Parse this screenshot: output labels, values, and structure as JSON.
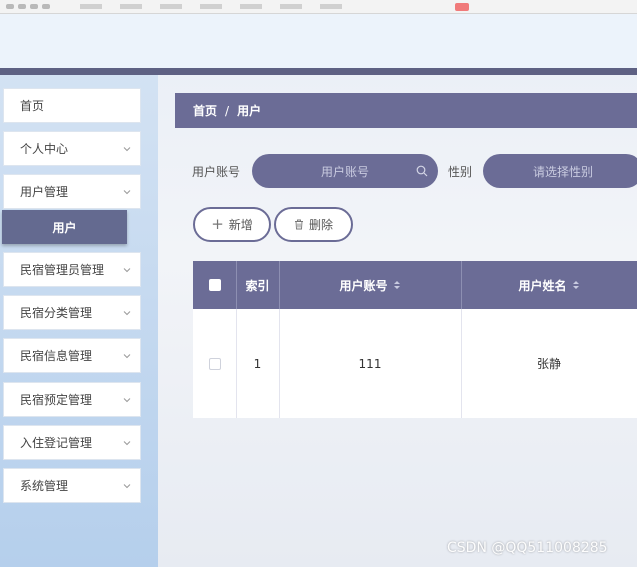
{
  "sidebar": {
    "items": [
      {
        "label": "首页",
        "has_chevron": false
      },
      {
        "label": "个人中心",
        "has_chevron": true
      },
      {
        "label": "用户管理",
        "has_chevron": true
      },
      {
        "label": "民宿管理员管理",
        "has_chevron": true
      },
      {
        "label": "民宿分类管理",
        "has_chevron": true
      },
      {
        "label": "民宿信息管理",
        "has_chevron": true
      },
      {
        "label": "民宿预定管理",
        "has_chevron": true
      },
      {
        "label": "入住登记管理",
        "has_chevron": true
      },
      {
        "label": "系统管理",
        "has_chevron": true
      }
    ],
    "active_sub": "用户"
  },
  "breadcrumb": {
    "home": "首页",
    "separator": "/",
    "current": "用户"
  },
  "search": {
    "account_label": "用户账号",
    "account_placeholder": "用户账号",
    "gender_label": "性别",
    "gender_placeholder": "请选择性别"
  },
  "actions": {
    "add_label": "新增",
    "delete_label": "删除"
  },
  "table": {
    "headers": {
      "index": "索引",
      "account": "用户账号",
      "name": "用户姓名"
    },
    "rows": [
      {
        "index": "1",
        "account": "111",
        "name": "张静"
      }
    ]
  },
  "watermark": "CSDN @QQ511008285",
  "colors": {
    "accent": "#6b6c96",
    "sidebar_top": "#d3e2f3",
    "sidebar_bottom": "#b5cfec",
    "header_bar": "#5e6183"
  }
}
